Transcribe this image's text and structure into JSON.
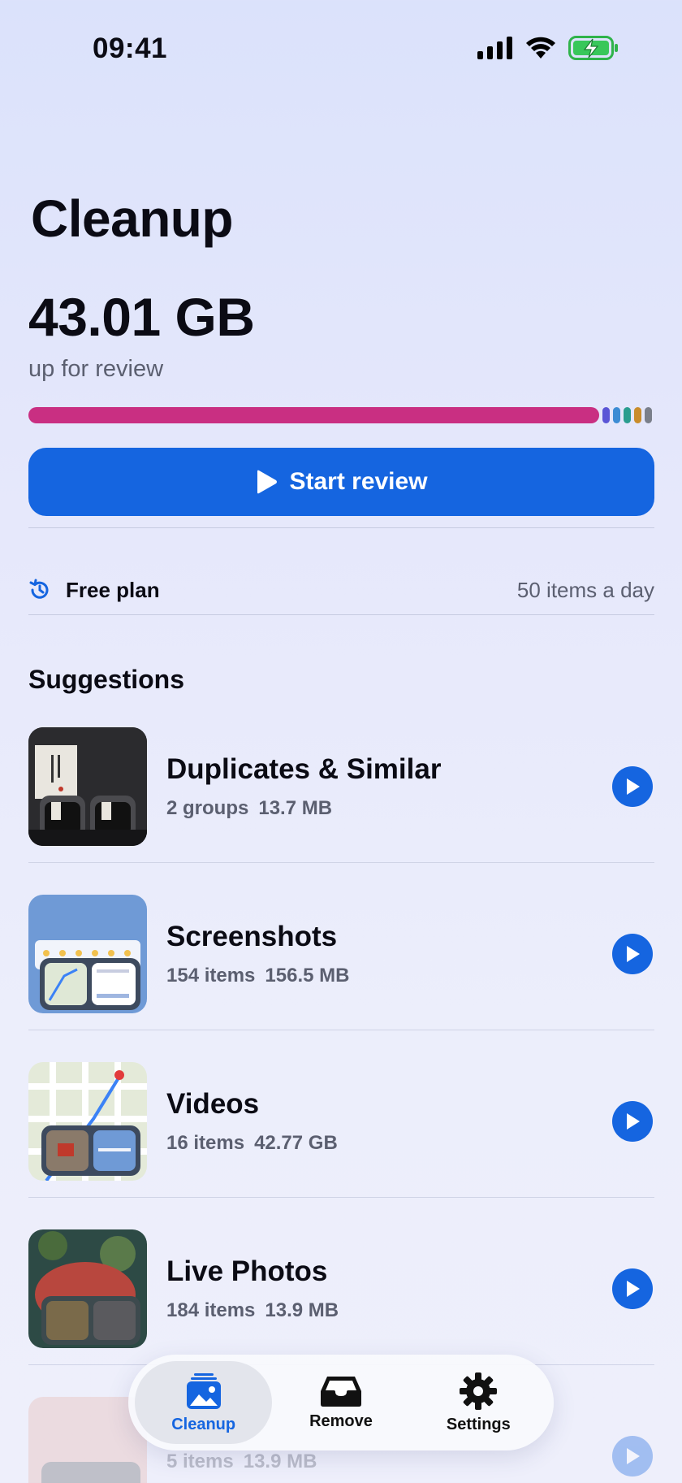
{
  "status_bar": {
    "time": "09:41"
  },
  "header": {
    "title": "Cleanup",
    "total_size": "43.01 GB",
    "subtitle": "up for review"
  },
  "colors": {
    "accent": "#1565e0",
    "usage_segments": [
      "#c92f82",
      "#5a55d6",
      "#3c8cd4",
      "#2a9d8f",
      "#c98c2a",
      "#7a7f8a"
    ]
  },
  "start_button": {
    "label": "Start review",
    "icon": "play-icon"
  },
  "plan": {
    "icon": "history-icon",
    "label": "Free plan",
    "limit": "50 items a day"
  },
  "suggestions": {
    "title": "Suggestions",
    "items": [
      {
        "title": "Duplicates & Similar",
        "count": "2 groups",
        "size": "13.7 MB"
      },
      {
        "title": "Screenshots",
        "count": "154 items",
        "size": "156.5 MB"
      },
      {
        "title": "Videos",
        "count": "16 items",
        "size": "42.77 GB"
      },
      {
        "title": "Live Photos",
        "count": "184 items",
        "size": "13.9 MB"
      },
      {
        "title": "",
        "count": "5 items",
        "size": "13.9 MB"
      }
    ]
  },
  "tab_bar": {
    "tabs": [
      {
        "label": "Cleanup",
        "icon": "photo-stack-icon",
        "active": true
      },
      {
        "label": "Remove",
        "icon": "tray-icon",
        "active": false
      },
      {
        "label": "Settings",
        "icon": "gear-icon",
        "active": false
      }
    ]
  }
}
